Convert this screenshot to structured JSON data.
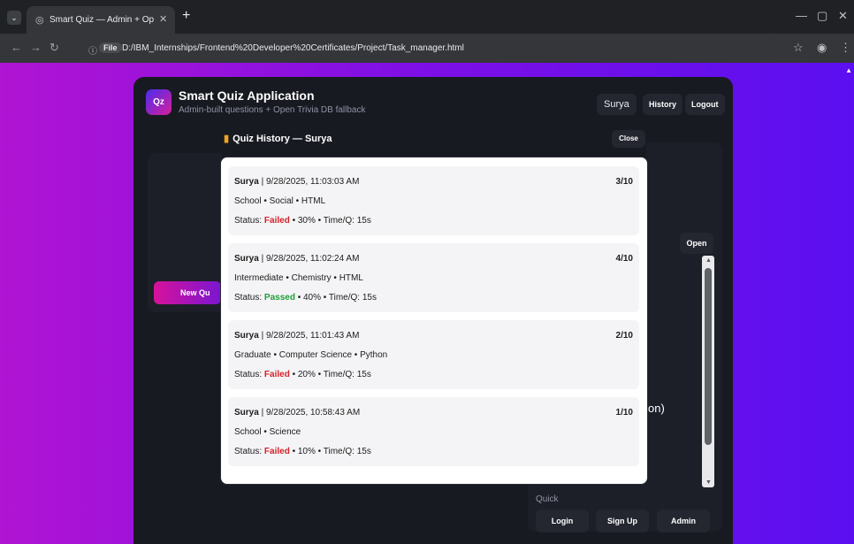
{
  "browser": {
    "tab_title": "Smart Quiz — Admin + Open",
    "tab_icon": "globe-icon",
    "url_chip": "File",
    "url": "D:/IBM_Internships/Frontend%20Developer%20Certificates/Project/Task_manager.html",
    "win_min": "—",
    "win_max": "▢",
    "win_close": "✕"
  },
  "app": {
    "logo": "Qz",
    "title": "Smart Quiz Application",
    "subtitle": "Admin-built questions + Open Trivia DB fallback",
    "username": "Surya",
    "history_btn": "History",
    "logout_btn": "Logout",
    "new_quiz_btn": "New Qu",
    "open_btn": "Open",
    "right_text": "on)",
    "quick_label": "Quick",
    "login_btn": "Login",
    "signup_btn": "Sign Up",
    "admin_btn": "Admin"
  },
  "modal": {
    "title": "Quiz History — Surya",
    "close_btn": "Close",
    "entries": [
      {
        "user": "Surya",
        "datetime": " | 9/28/2025, 11:03:03 AM",
        "meta": "School • Social • HTML",
        "status_prefix": "Status: ",
        "status": "Failed",
        "status_suffix": " • 30% • Time/Q: 15s",
        "score": "3/10"
      },
      {
        "user": "Surya",
        "datetime": " | 9/28/2025, 11:02:24 AM",
        "meta": "Intermediate • Chemistry • HTML",
        "status_prefix": "Status: ",
        "status": "Passed",
        "status_suffix": " • 40% • Time/Q: 15s",
        "score": "4/10"
      },
      {
        "user": "Surya",
        "datetime": " | 9/28/2025, 11:01:43 AM",
        "meta": "Graduate • Computer Science • Python",
        "status_prefix": "Status: ",
        "status": "Failed",
        "status_suffix": " • 20% • Time/Q: 15s",
        "score": "2/10"
      },
      {
        "user": "Surya",
        "datetime": " | 9/28/2025, 10:58:43 AM",
        "meta": "School • Science",
        "status_prefix": "Status: ",
        "status": "Failed",
        "status_suffix": " • 10% • Time/Q: 15s",
        "score": "1/10"
      }
    ]
  },
  "colors": {
    "failed": "#d6222a",
    "passed": "#1f9d3a",
    "gradient_start": "#b114d3",
    "gradient_end": "#5b0ff0"
  }
}
